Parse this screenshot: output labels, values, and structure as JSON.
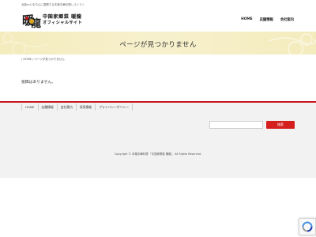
{
  "header": {
    "tagline": "北陸roll を中心に展開する本格中華料理レストラン",
    "logo_name": "中国家郷菜 暖龍",
    "logo_sub": "オフィシャルサイト",
    "nav": [
      "HOME",
      "店舗情報",
      "会社案内"
    ]
  },
  "hero": {
    "title": "ページが見つかりません"
  },
  "breadcrumb": {
    "home": "HOME",
    "separator": "/",
    "current": "ページが見つかりません"
  },
  "main": {
    "message": "投稿はありません。"
  },
  "footer": {
    "nav": [
      "HOME",
      "店舗情報",
      "会社案内",
      "採用情報",
      "プライバシーポリシー"
    ],
    "search": {
      "value": "",
      "button_label": "検索"
    },
    "copyright": "Copyright © 本格中華料理 「中国家郷菜 暖龍」 All Rights Reserved."
  },
  "colors": {
    "accent_red": "#c8161d",
    "button_red": "#d51f1f",
    "hero_bg": "#f4ecbd"
  },
  "icons": {
    "logo": "dragon-logo-icon",
    "recaptcha": "recaptcha-icon"
  }
}
